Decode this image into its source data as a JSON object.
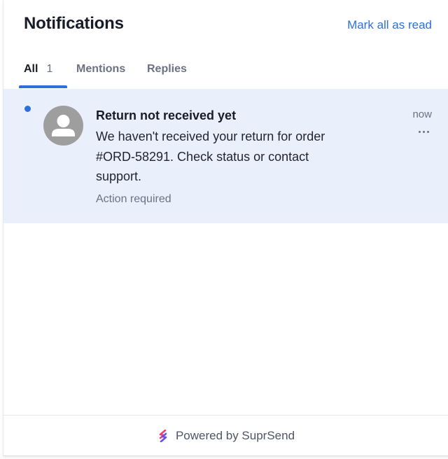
{
  "header": {
    "title": "Notifications",
    "mark_all_label": "Mark all as read"
  },
  "tabs": [
    {
      "label": "All",
      "count": "1",
      "active": true
    },
    {
      "label": "Mentions"
    },
    {
      "label": "Replies"
    }
  ],
  "notification": {
    "unread": true,
    "avatar_icon": "user-avatar-icon",
    "title": "Return not received yet",
    "body_lines": [
      "We haven't received your return for order",
      "#ORD-58291. Check status or contact",
      "support."
    ],
    "action_text": "Action required",
    "time": "now",
    "more_icon": "ellipsis-icon"
  },
  "footer": {
    "text": "Powered by SuprSend",
    "logo_icon": "suprsend-logo-icon"
  },
  "colors": {
    "accent": "#2f6fdb",
    "unread_bg": "#e9f0fb",
    "avatar": "#9e9e9e",
    "muted_text": "#6a7385"
  }
}
